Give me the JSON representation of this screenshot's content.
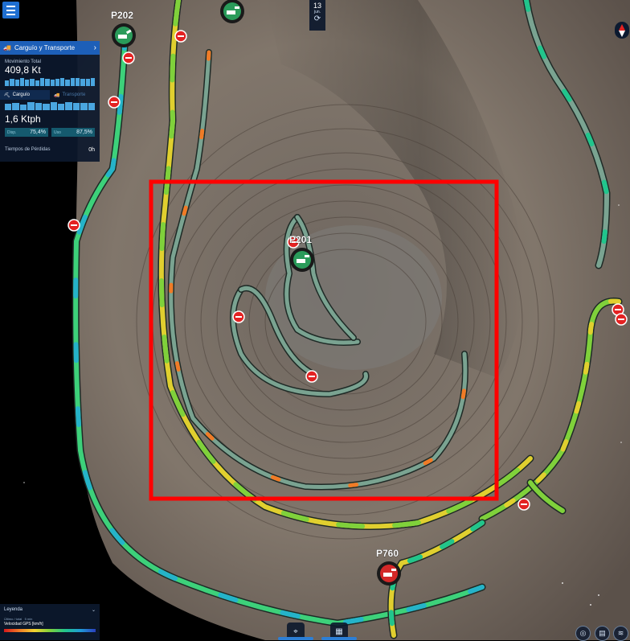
{
  "colors": {
    "accent": "#1d5fb8",
    "road": "#7aa391",
    "highlight_box": "#ff0000",
    "shovel_green": "#2a9b5a",
    "shovel_red": "#d32828",
    "stop_red": "#e32222"
  },
  "panel": {
    "title": "Carguío y Transporte",
    "movement_label": "Movimiento Total",
    "movement_value": "409,8 Kt",
    "tab_loading": "Carguío",
    "tab_transport": "Transporte",
    "rate_value": "1,6 Ktph",
    "disp_label": "Disp.",
    "disp_value": "75,4%",
    "use_label": "Uso",
    "use_value": "87,5%",
    "lost_time_label": "Tiempos de Pérdidas",
    "lost_time_value": "0h"
  },
  "date_chip": {
    "day": "13",
    "month": "jun."
  },
  "shovels": [
    {
      "label": "P202",
      "status": "green",
      "icon": "shovel-icon"
    },
    {
      "label": "P201",
      "status": "green",
      "icon": "shovel-icon"
    },
    {
      "label": "P760",
      "status": "red",
      "icon": "shovel-icon"
    },
    {
      "label": "",
      "status": "green",
      "icon": "shovel-icon"
    }
  ],
  "legend": {
    "title": "Leyenda",
    "option_1": "Último / total",
    "option_2": "5 min",
    "metric": "Velocidad GPS [km/h]"
  },
  "icons": {
    "menu": "menu-icon",
    "compass": "compass-icon",
    "stop": "stop-icon",
    "refresh": "refresh-icon",
    "locate": "locate-icon",
    "grid": "grid-icon",
    "layers": "layers-icon"
  }
}
